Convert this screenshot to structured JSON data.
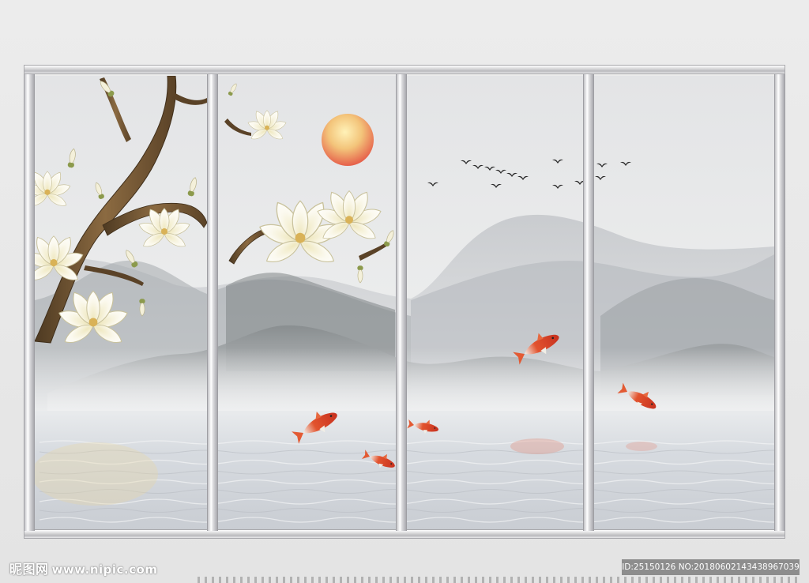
{
  "watermark": {
    "logo_text": "昵图网",
    "site_text": "www.nipic.com"
  },
  "image_id": {
    "text": "ID:25150126 NO:20180602143438967039"
  },
  "colors": {
    "background": "#e8e8e8",
    "frame": "#c8c8cc",
    "sky": "#e6e7e9",
    "mountain_far": "#c4c6ca",
    "mountain_near": "#8d9294",
    "water": "#d9dde1",
    "sun": "#f0b76a",
    "koi": "#d8402a",
    "magnolia": "#f7f4e3",
    "branch": "#6e5332",
    "bird": "#2c2c2c"
  },
  "icons": [
    "magnolia-flower-icon",
    "koi-fish-icon",
    "bird-icon",
    "sun-icon"
  ]
}
